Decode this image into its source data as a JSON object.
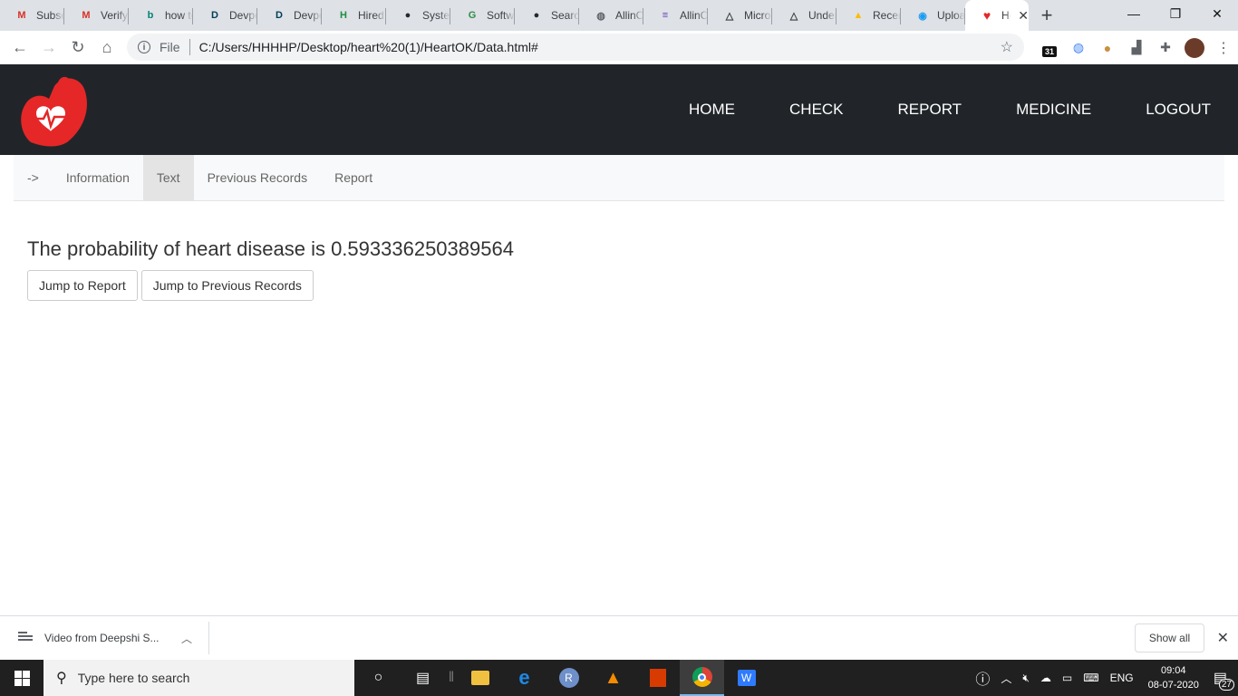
{
  "browser": {
    "tabs": [
      {
        "title": "Subscriptions",
        "icon": "gmail-icon",
        "color": "#d93025",
        "glyph": "M"
      },
      {
        "title": "Verify",
        "icon": "gmail-icon",
        "color": "#d93025",
        "glyph": "M"
      },
      {
        "title": "how to",
        "icon": "bing-icon",
        "color": "#008373",
        "glyph": "b"
      },
      {
        "title": "Devpost",
        "icon": "devpost-icon",
        "color": "#003e54",
        "glyph": "D"
      },
      {
        "title": "Devpost",
        "icon": "devpost-icon",
        "color": "#003e54",
        "glyph": "D"
      },
      {
        "title": "Hired",
        "icon": "hired-icon",
        "color": "#1e8e3e",
        "glyph": "H"
      },
      {
        "title": "System",
        "icon": "github-icon",
        "color": "#24292e",
        "glyph": "●"
      },
      {
        "title": "Software",
        "icon": "gfg-icon",
        "color": "#2f8d46",
        "glyph": "G"
      },
      {
        "title": "Search",
        "icon": "github-icon",
        "color": "#24292e",
        "glyph": "●"
      },
      {
        "title": "AllinC",
        "icon": "globe-icon",
        "color": "#5f6368",
        "glyph": "◍"
      },
      {
        "title": "AllinC",
        "icon": "form-icon",
        "color": "#673ab7",
        "glyph": "≡"
      },
      {
        "title": "Micro",
        "icon": "drive-triangle-icon",
        "color": "#3c4043",
        "glyph": "△"
      },
      {
        "title": "Under",
        "icon": "drive-triangle-icon",
        "color": "#3c4043",
        "glyph": "△"
      },
      {
        "title": "Recent",
        "icon": "google-drive-icon",
        "color": "#fbbc04",
        "glyph": "▲"
      },
      {
        "title": "Upload",
        "icon": "upload-icon",
        "color": "#1a9cf0",
        "glyph": "◉"
      }
    ],
    "active_tab": {
      "title": "He",
      "icon": "heart-favicon-icon",
      "color": "#e52727",
      "glyph": "♥"
    },
    "url_scheme": "File",
    "url": "C:/Users/HHHHP/Desktop/heart%20(1)/HeartOK/Data.html#",
    "calendar_badge": "31"
  },
  "site": {
    "nav": [
      "HOME",
      "CHECK",
      "REPORT",
      "MEDICINE",
      "LOGOUT"
    ],
    "subnav": [
      "->",
      "Information",
      "Text",
      "Previous Records",
      "Report"
    ],
    "subnav_active": "Text",
    "probability_text": "The probability of heart disease is 0.593336250389564",
    "buttons": {
      "report": "Jump to Report",
      "previous": "Jump to Previous Records"
    }
  },
  "downloads": {
    "item_name": "Video from Deepshi S...",
    "show_all": "Show all"
  },
  "taskbar": {
    "search_placeholder": "Type here to search",
    "language": "ENG",
    "time": "09:04",
    "date": "08-07-2020",
    "notification_count": "27"
  },
  "colors": {
    "header_bg": "#212529",
    "logo_red": "#e52727",
    "subnav_bg": "#f8f9fa",
    "subnav_active_bg": "#e4e4e4"
  }
}
